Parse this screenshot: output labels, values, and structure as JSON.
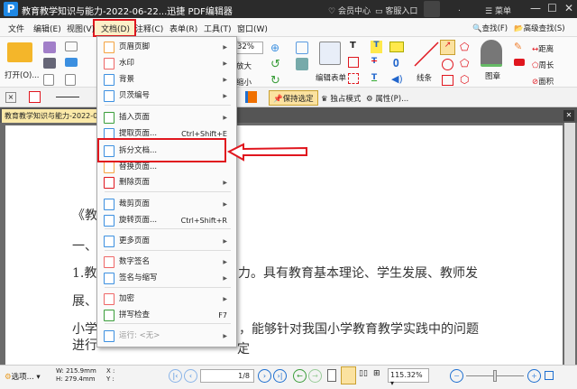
{
  "window": {
    "title": "教育教学知识与能力-2022-06-22...迅捷 PDF编辑器",
    "member_center": "会员中心",
    "support": "客服入口",
    "dot": ".",
    "menu_label": "菜单",
    "brand_color": "#1e88e5",
    "highlight_color": "#e0161e"
  },
  "menubar": [
    "文件",
    "编辑(E)",
    "视图(V)",
    "文档(D)",
    "注释(C)",
    "表单(R)",
    "工具(T)",
    "窗口(W)"
  ],
  "ribbon": {
    "open": "打开(O)...",
    "zoom_partial": "32%",
    "zoom_in": "放大",
    "zoom_out": "缩小",
    "edit_form": "编辑表单",
    "lines": "线条",
    "stamp": "图章",
    "distance": "距离",
    "perimeter": "周长",
    "area": "面积",
    "find": "查找(F)",
    "advanced_find": "高级查找(S)"
  },
  "toolbar2": {
    "keep_selected": "保持选定",
    "exclusive_mode": "独占模式",
    "properties": "属性(P)..."
  },
  "doc_tab": "教育教学知识与能力-2022-06-22",
  "document_lines": [
    "《教",
    "一、",
    "1.教",
    "力。具有教育基本理论、学生发展、教师发",
    "展、",
    "小学",
    "，能够针对我国小学教育教学实践中的问题",
    "进行",
    "定"
  ],
  "doc_menu": {
    "items": [
      {
        "label": "页眉页脚",
        "submenu": true
      },
      {
        "label": "水印",
        "submenu": true
      },
      {
        "label": "背景",
        "submenu": true
      },
      {
        "label": "贝茨编号",
        "submenu": true
      },
      {
        "label": "插入页面",
        "submenu": true
      },
      {
        "label": "提取页面...",
        "shortcut": "Ctrl+Shift+E"
      },
      {
        "label": "拆分文档..."
      },
      {
        "label": "替换页面..."
      },
      {
        "label": "删除页面",
        "submenu": true
      },
      {
        "label": "裁剪页面",
        "submenu": true
      },
      {
        "label": "旋转页面...",
        "shortcut": "Ctrl+Shift+R"
      },
      {
        "label": "更多页面",
        "submenu": true
      },
      {
        "label": "数字签名",
        "submenu": true
      },
      {
        "label": "签名与缩写",
        "submenu": true
      },
      {
        "label": "加密",
        "submenu": true
      },
      {
        "label": "拼写检查",
        "shortcut": "F7"
      },
      {
        "label": "运行: <无>",
        "submenu": true,
        "disabled": true
      }
    ]
  },
  "statusbar": {
    "options": "选项...",
    "width": "W: 215.9mm",
    "height": "H: 279.4mm",
    "x": "X :",
    "y": "Y :",
    "page": "1/8",
    "zoom": "115.32%",
    "zoom_slider_percent": 50
  }
}
